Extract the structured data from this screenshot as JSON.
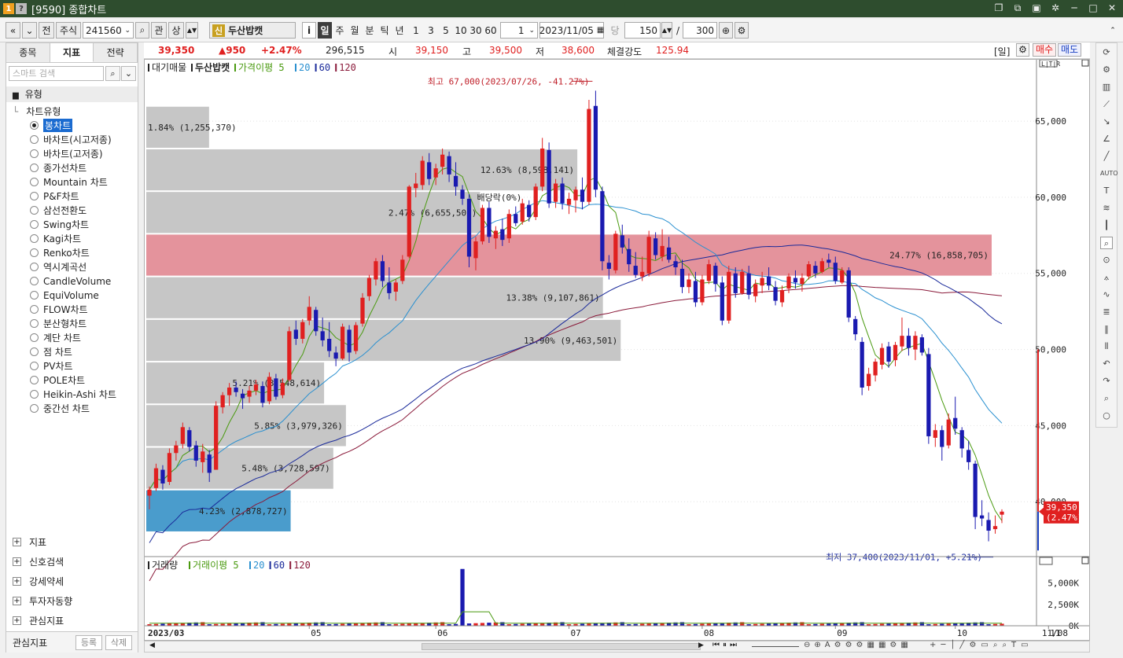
{
  "window": {
    "title": "[9590] 종합차트",
    "icons": [
      "app-icon-1",
      "help-icon"
    ],
    "controls": [
      "new-window-icon",
      "link-icon",
      "copy-icon",
      "settings-icon",
      "minimize-icon",
      "maximize-icon",
      "close-icon"
    ]
  },
  "toolbar": {
    "prev": "«",
    "down": "»",
    "jeon": "전",
    "market": "주식",
    "code": "241560",
    "gwan": "관",
    "sang": "상",
    "shin": "신",
    "stock_name": "두산밥캣",
    "info": "i",
    "periods": [
      "일",
      "주",
      "월",
      "분",
      "틱",
      "년"
    ],
    "active_period": "일",
    "intervals": [
      "1",
      "3",
      "5",
      "10",
      "30",
      "60"
    ],
    "unit_value": "1",
    "date": "2023/11/05",
    "dang": "당",
    "count": "150",
    "slash": "/",
    "total": "300"
  },
  "sidebar": {
    "tabs": [
      "종목",
      "지표",
      "전략"
    ],
    "active_tab": "지표",
    "search_placeholder": "스마트 검색",
    "section": "유형",
    "tree_root": "차트유형",
    "chart_types": [
      "봉차트",
      "바차트(시고저종)",
      "바차트(고저종)",
      "종가선차트",
      "Mountain 차트",
      "P&F차트",
      "삼선전환도",
      "Swing차트",
      "Kagi차트",
      "Renko차트",
      "역시계곡선",
      "CandleVolume",
      "EquiVolume",
      "FLOW차트",
      "분산형차트",
      "계단 차트",
      "점 차트",
      "PV차트",
      "POLE차트",
      "Heikin-Ashi 차트",
      "중간선 차트"
    ],
    "selected_type": "봉차트",
    "groups": [
      "지표",
      "신호검색",
      "강세약세",
      "투자자동향",
      "관심지표"
    ],
    "footer_label": "관심지표",
    "register": "등록",
    "delete": "삭제"
  },
  "quote": {
    "price": "39,350",
    "change": "▲950",
    "pct": "+2.47%",
    "volume": "296,515",
    "open_label": "시",
    "open": "39,150",
    "high_label": "고",
    "high": "39,500",
    "low_label": "저",
    "low": "38,600",
    "strength_label": "체결강도",
    "strength": "125.94",
    "period_tag": "[일]",
    "buy": "매수",
    "sell": "매도"
  },
  "colors": {
    "up": "#e02020",
    "down": "#1a1ab0",
    "ma5": "#4a9a10",
    "ma20": "#2a90d0",
    "ma60": "#1a2a9a",
    "ma120": "#8a1a3a",
    "profile_gray": "#c6c6c6",
    "profile_poc": "#e4939c",
    "profile_current": "#4a9ccc"
  },
  "chart_data": [
    {
      "type": "candlestick",
      "legend": {
        "items": [
          {
            "label": "대기매물",
            "color": "#222"
          },
          {
            "label": "두산밥캣",
            "color": "#222",
            "bold": true
          },
          {
            "label": "가격이평 5",
            "color": "#4a9a10"
          },
          {
            "label": "20",
            "color": "#2a90d0"
          },
          {
            "label": "60",
            "color": "#1a2a9a"
          },
          {
            "label": "120",
            "color": "#8a1a3a"
          }
        ]
      },
      "y_ticks": [
        "40,000",
        "45,000",
        "50,000",
        "55,000",
        "60,000",
        "65,000"
      ],
      "ylim": [
        36500,
        68000
      ],
      "x_ticks": [
        "2023/03",
        "05",
        "06",
        "07",
        "08",
        "09",
        "10",
        "11"
      ],
      "x_end_label": "11/08",
      "current_price_tag": [
        "39,350",
        "(2.47%)"
      ],
      "annotations": {
        "high": "최고 67,000(2023/07/26, -41.27%)",
        "low": "최저 37,400(2023/11/01, +5.21%)",
        "dividend": "배당락(0%)"
      },
      "volume_profile": [
        {
          "label": "1.84% (1,255,370)",
          "lo": 63200,
          "hi": 66000,
          "pct": 1.84
        },
        {
          "label": "12.63% (8,598,141)",
          "lo": 60400,
          "hi": 63200,
          "pct": 12.63
        },
        {
          "label": "2.47% (6,655,502)",
          "lo": 57600,
          "hi": 60400,
          "pct": 9.78
        },
        {
          "label": "24.77% (16,858,705)",
          "lo": 54800,
          "hi": 57600,
          "pct": 24.77
        },
        {
          "label": "13.38% (9,107,861)",
          "lo": 52000,
          "hi": 54800,
          "pct": 13.38
        },
        {
          "label": "13.90% (9,463,501)",
          "lo": 49200,
          "hi": 52000,
          "pct": 13.9
        },
        {
          "label": "5.21% (3,548,614)",
          "lo": 46400,
          "hi": 49200,
          "pct": 5.21
        },
        {
          "label": "5.85% (3,979,326)",
          "lo": 43600,
          "hi": 46400,
          "pct": 5.85
        },
        {
          "label": "5.48% (3,728,597)",
          "lo": 40800,
          "hi": 43600,
          "pct": 5.48
        },
        {
          "label": "4.23% (2,878,727)",
          "lo": 38000,
          "hi": 40800,
          "pct": 4.23
        }
      ],
      "ohlc": [
        [
          40400,
          41000,
          39500,
          40800
        ],
        [
          40900,
          42500,
          40700,
          42200
        ],
        [
          42100,
          42400,
          40800,
          41200
        ],
        [
          41300,
          43500,
          41100,
          43200
        ],
        [
          43200,
          44000,
          42700,
          43700
        ],
        [
          43800,
          45200,
          43500,
          44900
        ],
        [
          44700,
          44900,
          43300,
          43600
        ],
        [
          43700,
          44000,
          42300,
          42700
        ],
        [
          42600,
          43800,
          41900,
          43300
        ],
        [
          43100,
          43400,
          41300,
          41900
        ],
        [
          42100,
          46600,
          42100,
          46300
        ],
        [
          46200,
          47200,
          45800,
          47000
        ],
        [
          47000,
          47800,
          46300,
          47500
        ],
        [
          47500,
          47900,
          46900,
          47200
        ],
        [
          47100,
          47400,
          46100,
          46800
        ],
        [
          46900,
          47600,
          46500,
          47300
        ],
        [
          47300,
          48000,
          47000,
          47700
        ],
        [
          47600,
          47900,
          46200,
          46500
        ],
        [
          46600,
          48500,
          46400,
          48200
        ],
        [
          48100,
          48400,
          46700,
          46900
        ],
        [
          47000,
          48100,
          46800,
          47800
        ],
        [
          48000,
          51500,
          47900,
          51200
        ],
        [
          51300,
          51900,
          50300,
          50700
        ],
        [
          50700,
          52000,
          50400,
          51800
        ],
        [
          51900,
          53500,
          51600,
          52800
        ],
        [
          52600,
          52800,
          50900,
          51200
        ],
        [
          51200,
          52100,
          50200,
          50600
        ],
        [
          50700,
          51800,
          49500,
          49900
        ],
        [
          49800,
          50200,
          48900,
          49400
        ],
        [
          49400,
          51700,
          49300,
          51500
        ],
        [
          51300,
          51600,
          49200,
          49800
        ],
        [
          49900,
          51800,
          49700,
          51600
        ],
        [
          51700,
          53700,
          51500,
          53400
        ],
        [
          53500,
          54900,
          53200,
          54700
        ],
        [
          54600,
          56000,
          54200,
          55800
        ],
        [
          55800,
          56200,
          54100,
          54500
        ],
        [
          54400,
          55400,
          53300,
          53700
        ],
        [
          53800,
          54600,
          53200,
          54400
        ],
        [
          54500,
          56200,
          54300,
          55900
        ],
        [
          56100,
          60800,
          56000,
          60700
        ],
        [
          60600,
          61600,
          60000,
          60900
        ],
        [
          60800,
          62700,
          60500,
          62400
        ],
        [
          62300,
          62900,
          60800,
          61200
        ],
        [
          61300,
          62200,
          60800,
          61900
        ],
        [
          62000,
          63200,
          61500,
          62800
        ],
        [
          62700,
          63000,
          61000,
          61500
        ],
        [
          61400,
          62300,
          60100,
          60700
        ],
        [
          60500,
          60800,
          59500,
          59900
        ],
        [
          59900,
          60200,
          55400,
          56100
        ],
        [
          56000,
          57400,
          55200,
          57100
        ],
        [
          57100,
          59500,
          56900,
          59300
        ],
        [
          59300,
          59700,
          57000,
          57400
        ],
        [
          57300,
          58100,
          56600,
          57800
        ],
        [
          57900,
          58600,
          56800,
          57200
        ],
        [
          57300,
          59200,
          57000,
          58900
        ],
        [
          58900,
          59400,
          58100,
          58300
        ],
        [
          58400,
          59900,
          58200,
          59600
        ],
        [
          59500,
          59800,
          58400,
          58700
        ],
        [
          58700,
          60900,
          58500,
          60700
        ],
        [
          60700,
          63900,
          60400,
          63200
        ],
        [
          63100,
          63600,
          59300,
          59600
        ],
        [
          59700,
          61200,
          59300,
          60900
        ],
        [
          60900,
          61300,
          59200,
          59600
        ],
        [
          59500,
          60300,
          58900,
          59900
        ],
        [
          59800,
          60700,
          59000,
          60500
        ],
        [
          60500,
          61300,
          59200,
          59700
        ],
        [
          59700,
          66400,
          59500,
          65800
        ],
        [
          66000,
          67000,
          60000,
          60500
        ],
        [
          60400,
          60700,
          55200,
          55800
        ],
        [
          55700,
          56200,
          54600,
          55300
        ],
        [
          55200,
          57800,
          55000,
          57600
        ],
        [
          57500,
          58200,
          56300,
          56700
        ],
        [
          56600,
          57300,
          55100,
          55600
        ],
        [
          55500,
          56400,
          54700,
          54900
        ],
        [
          54800,
          56100,
          54500,
          55100
        ],
        [
          55000,
          57800,
          54800,
          57400
        ],
        [
          57300,
          57700,
          55900,
          56200
        ],
        [
          56100,
          57900,
          55800,
          56800
        ],
        [
          56700,
          57400,
          55700,
          55900
        ],
        [
          55800,
          56200,
          54900,
          55400
        ],
        [
          55300,
          55900,
          53700,
          54100
        ],
        [
          54100,
          55000,
          53700,
          54600
        ],
        [
          54500,
          55100,
          52800,
          53100
        ],
        [
          53100,
          54900,
          52900,
          54600
        ],
        [
          54500,
          55900,
          54300,
          55600
        ],
        [
          55500,
          55700,
          53800,
          54300
        ],
        [
          54400,
          54800,
          51600,
          51900
        ],
        [
          51900,
          55500,
          51700,
          55100
        ],
        [
          55000,
          55400,
          53400,
          53700
        ],
        [
          53700,
          55300,
          53600,
          55100
        ],
        [
          55000,
          55500,
          53300,
          53600
        ],
        [
          53500,
          54600,
          53100,
          54300
        ],
        [
          54200,
          55100,
          53700,
          54700
        ],
        [
          54800,
          55400,
          53900,
          54200
        ],
        [
          54100,
          54500,
          52900,
          53200
        ],
        [
          53100,
          54200,
          52800,
          53900
        ],
        [
          54000,
          55000,
          53700,
          54800
        ],
        [
          54700,
          55200,
          54000,
          54400
        ],
        [
          54300,
          55000,
          53800,
          54700
        ],
        [
          54800,
          55800,
          54600,
          55600
        ],
        [
          55500,
          55800,
          54700,
          55000
        ],
        [
          55100,
          56000,
          55000,
          55800
        ],
        [
          55900,
          56300,
          55400,
          55700
        ],
        [
          55700,
          56100,
          54300,
          54500
        ],
        [
          54400,
          55400,
          54300,
          55200
        ],
        [
          55200,
          55400,
          51800,
          52100
        ],
        [
          52000,
          52200,
          50600,
          51000
        ],
        [
          50500,
          50800,
          47000,
          47500
        ],
        [
          47600,
          48800,
          47300,
          48400
        ],
        [
          48300,
          49400,
          47900,
          49200
        ],
        [
          49000,
          50400,
          48700,
          50100
        ],
        [
          50200,
          50500,
          48800,
          49200
        ],
        [
          49300,
          50500,
          48900,
          50300
        ],
        [
          50200,
          52100,
          49900,
          50900
        ],
        [
          50900,
          51400,
          49600,
          50100
        ],
        [
          50000,
          51200,
          49300,
          50900
        ],
        [
          50800,
          51000,
          49600,
          49800
        ],
        [
          49700,
          50100,
          43800,
          44300
        ],
        [
          44200,
          45100,
          43600,
          44700
        ],
        [
          44700,
          45000,
          42700,
          43600
        ],
        [
          43700,
          45800,
          43500,
          45400
        ],
        [
          45500,
          46900,
          44400,
          44800
        ],
        [
          44700,
          44900,
          42900,
          43500
        ],
        [
          43400,
          44000,
          42100,
          42600
        ],
        [
          42500,
          42700,
          38200,
          39000
        ],
        [
          39100,
          40100,
          38400,
          38900
        ],
        [
          38800,
          39300,
          37400,
          38100
        ],
        [
          38200,
          39100,
          37900,
          38400
        ],
        [
          39150,
          39500,
          38600,
          39350
        ]
      ],
      "volume": {
        "label": "거래량",
        "legend": [
          {
            "label": "거래이평 5",
            "color": "#4a9a10"
          },
          {
            "label": "20",
            "color": "#2a90d0"
          },
          {
            "label": "60",
            "color": "#1a2a9a"
          },
          {
            "label": "120",
            "color": "#8a1a3a"
          }
        ],
        "y_ticks": [
          "0K",
          "2,500K",
          "5,000K"
        ],
        "ylim": [
          0,
          7000000
        ],
        "spike": 6655502
      }
    }
  ]
}
